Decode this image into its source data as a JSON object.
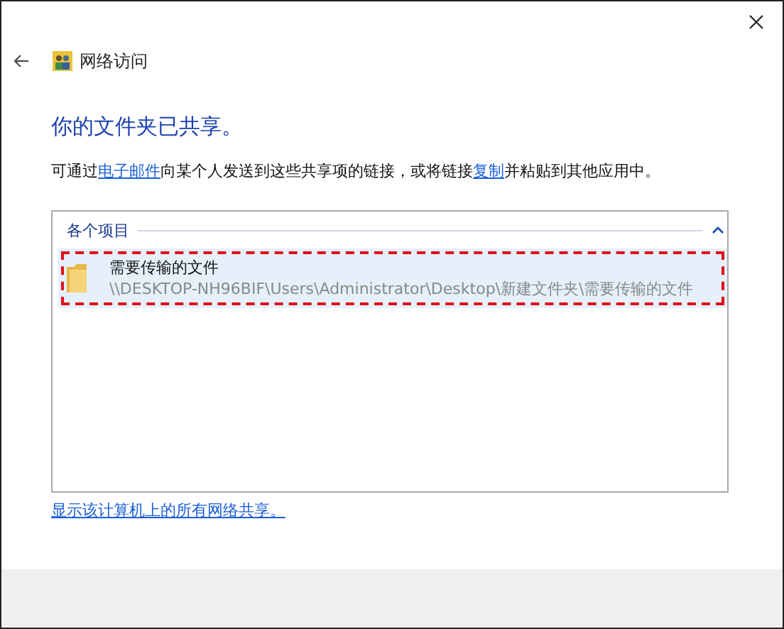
{
  "window": {
    "title": "网络访问"
  },
  "heading": "你的文件夹已共享。",
  "message": [
    {
      "kind": "text",
      "text": "可通过"
    },
    {
      "kind": "link",
      "text": "电子邮件"
    },
    {
      "kind": "text",
      "text": "向某个人发送到这些共享项的链接，或将链接"
    },
    {
      "kind": "link",
      "text": "复制"
    },
    {
      "kind": "text",
      "text": "并粘贴到其他应用中。"
    }
  ],
  "list": {
    "group": {
      "title": "各个项目",
      "expanded": true
    },
    "items": [
      {
        "name": "需要传输的文件",
        "path": "\\\\DESKTOP-NH96BIF\\Users\\Administrator\\Desktop\\新建文件夹\\需要传输的文件",
        "selected": true,
        "highlighted": true
      }
    ]
  },
  "show_all_link": "显示该计算机上的所有网络共享。"
}
